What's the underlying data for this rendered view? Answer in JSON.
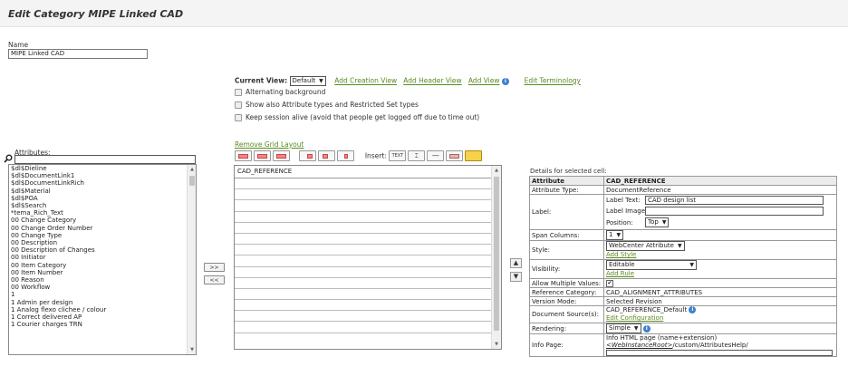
{
  "page": {
    "title": "Edit Category  MIPE Linked CAD"
  },
  "name_field": {
    "label": "Name",
    "value": "MIPE Linked CAD"
  },
  "view_bar": {
    "current_view_label": "Current View:",
    "current_view_value": "Default",
    "links": [
      "Add Creation View",
      "Add Header View",
      "Add View"
    ],
    "terminology_link": "Edit Terminology"
  },
  "options": [
    "Alternating background",
    "Show also Attribute types and Restricted Set types",
    "Keep session alive (avoid that people get logged off due to time out)"
  ],
  "attributes": {
    "label": "Attributes:",
    "search_value": "",
    "items": [
      "$dl$Dieline",
      "$dl$DocumentLink1",
      "$dl$DocumentLinkRich",
      "$dl$Material",
      "$dl$POA",
      "$dl$Search",
      "*tema_Rich_Text",
      "00 Change Category",
      "00 Change Order Number",
      "00 Change Type",
      "00 Description",
      "00 Description of Changes",
      "00 Initiator",
      "00 Item Category",
      "00 Item Number",
      "00 Reason",
      "00 Workflow",
      "1",
      "1 Admin per design",
      "1 Analog flexo clichee / colour",
      "1 Correct delivered AP",
      "1 Courier charges TRN"
    ]
  },
  "move_buttons": {
    "add": ">>",
    "remove": "<<"
  },
  "grid": {
    "remove_link": "Remove Grid Layout",
    "insert_label": "Insert:",
    "insert_text_btn": "TEXT",
    "header_cell": "CAD_REFERENCE",
    "row_count": 14
  },
  "details": {
    "title": "Details for selected cell:",
    "head": {
      "attr": "Attribute",
      "value": "CAD_REFERENCE"
    },
    "attribute_type": {
      "label": "Attribute Type:",
      "value": "DocumentReference"
    },
    "label_row": {
      "label": "Label:",
      "text_label": "Label Text:",
      "text_value": "CAD design list",
      "image_label": "Label Image:",
      "image_value": "",
      "position_label": "Position:",
      "position_value": "Top"
    },
    "span_columns": {
      "label": "Span Columns:",
      "value": "1"
    },
    "style": {
      "label": "Style:",
      "value": "WebCenter Attribute",
      "link": "Add Style"
    },
    "visibility": {
      "label": "Visibility:",
      "value": "Editable",
      "link": "Add Rule"
    },
    "allow_multiple": {
      "label": "Allow Multiple Values:",
      "checked": true
    },
    "reference_category": {
      "label": "Reference Category:",
      "value": "CAD_ALIGNMENT_ATTRIBUTES"
    },
    "version_mode": {
      "label": "Version Mode:",
      "value": "Selected Revision"
    },
    "document_source": {
      "label": "Document Source(s):",
      "value": "CAD_REFERENCE_Default",
      "link": "Edit Configuration"
    },
    "rendering": {
      "label": "Rendering:",
      "value": "Simple"
    },
    "info_page": {
      "label": "Info Page:",
      "line1": "Info HTML page (name+extension)",
      "line2_prefix": "<WebInstanceRoot>",
      "line2_suffix": "/custom/AttributesHelp/"
    }
  },
  "colors": {
    "link": "#5a8a1f",
    "info": "#3f7fce"
  }
}
